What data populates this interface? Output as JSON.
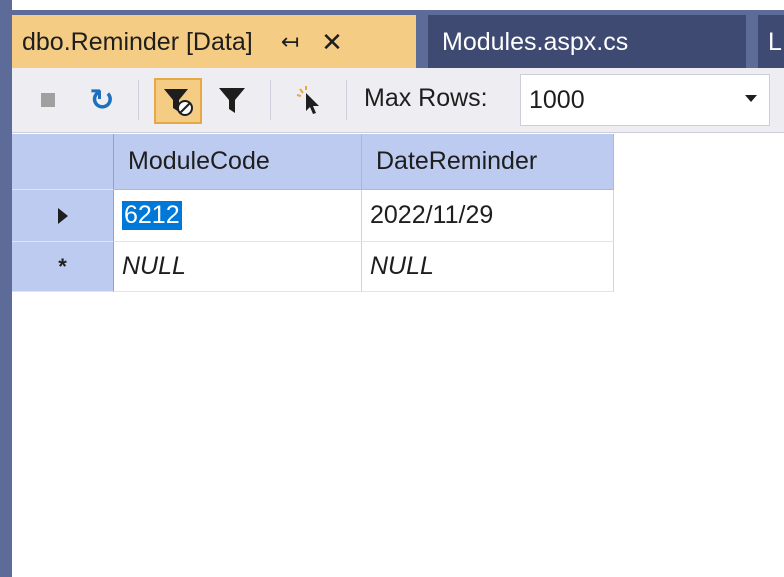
{
  "tabs": [
    {
      "label": "dbo.Reminder [Data]",
      "active": true,
      "pin_glyph": "↤",
      "close_glyph": "✕"
    },
    {
      "label": "Modules.aspx.cs",
      "active": false
    },
    {
      "label": "L",
      "active": false
    }
  ],
  "toolbar": {
    "max_rows_label": "Max Rows:",
    "max_rows_value": "1000",
    "refresh_glyph": "↻"
  },
  "grid": {
    "columns": [
      "ModuleCode",
      "DateReminder"
    ],
    "rows": [
      {
        "marker": "current",
        "values": [
          "6212",
          "2022/11/29"
        ]
      },
      {
        "marker": "new",
        "marker_glyph": "*",
        "values": [
          "NULL",
          "NULL"
        ]
      }
    ]
  },
  "colors": {
    "active_tab": "#f5cc84",
    "tab_strip": "#5d6b99",
    "header": "#bccbef",
    "selection": "#0078d7"
  },
  "icons": [
    "stop-icon",
    "refresh-icon",
    "filter-toggle-icon",
    "filter-icon",
    "pointer-icon",
    "dropdown-arrow-icon",
    "pin-icon",
    "close-icon"
  ]
}
